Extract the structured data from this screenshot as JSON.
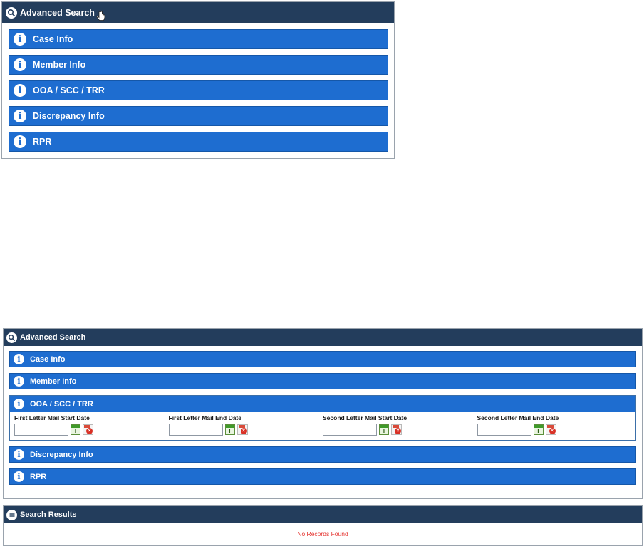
{
  "panel_top": {
    "title": "Advanced Search",
    "sections": [
      {
        "label": "Case Info"
      },
      {
        "label": "Member Info"
      },
      {
        "label": "OOA / SCC / TRR"
      },
      {
        "label": "Discrepancy Info"
      },
      {
        "label": "RPR"
      }
    ]
  },
  "panel_bottom": {
    "title": "Advanced Search",
    "sections": [
      {
        "label": "Case Info"
      },
      {
        "label": "Member Info"
      },
      {
        "label": "OOA / SCC / TRR"
      },
      {
        "label": "Discrepancy Info"
      },
      {
        "label": "RPR"
      }
    ],
    "date_fields": [
      {
        "label": "First Letter Mail Start Date",
        "value": ""
      },
      {
        "label": "First Letter Mail End Date",
        "value": ""
      },
      {
        "label": "Second Letter Mail Start Date",
        "value": ""
      },
      {
        "label": "Second Letter Mail End Date",
        "value": ""
      }
    ],
    "calendar_button_text": "T"
  },
  "results": {
    "title": "Search Results",
    "empty_message": "No Records Found"
  },
  "colors": {
    "header_navy": "#233d5c",
    "section_blue": "#1e6dd0",
    "empty_text_red": "#e53935"
  }
}
